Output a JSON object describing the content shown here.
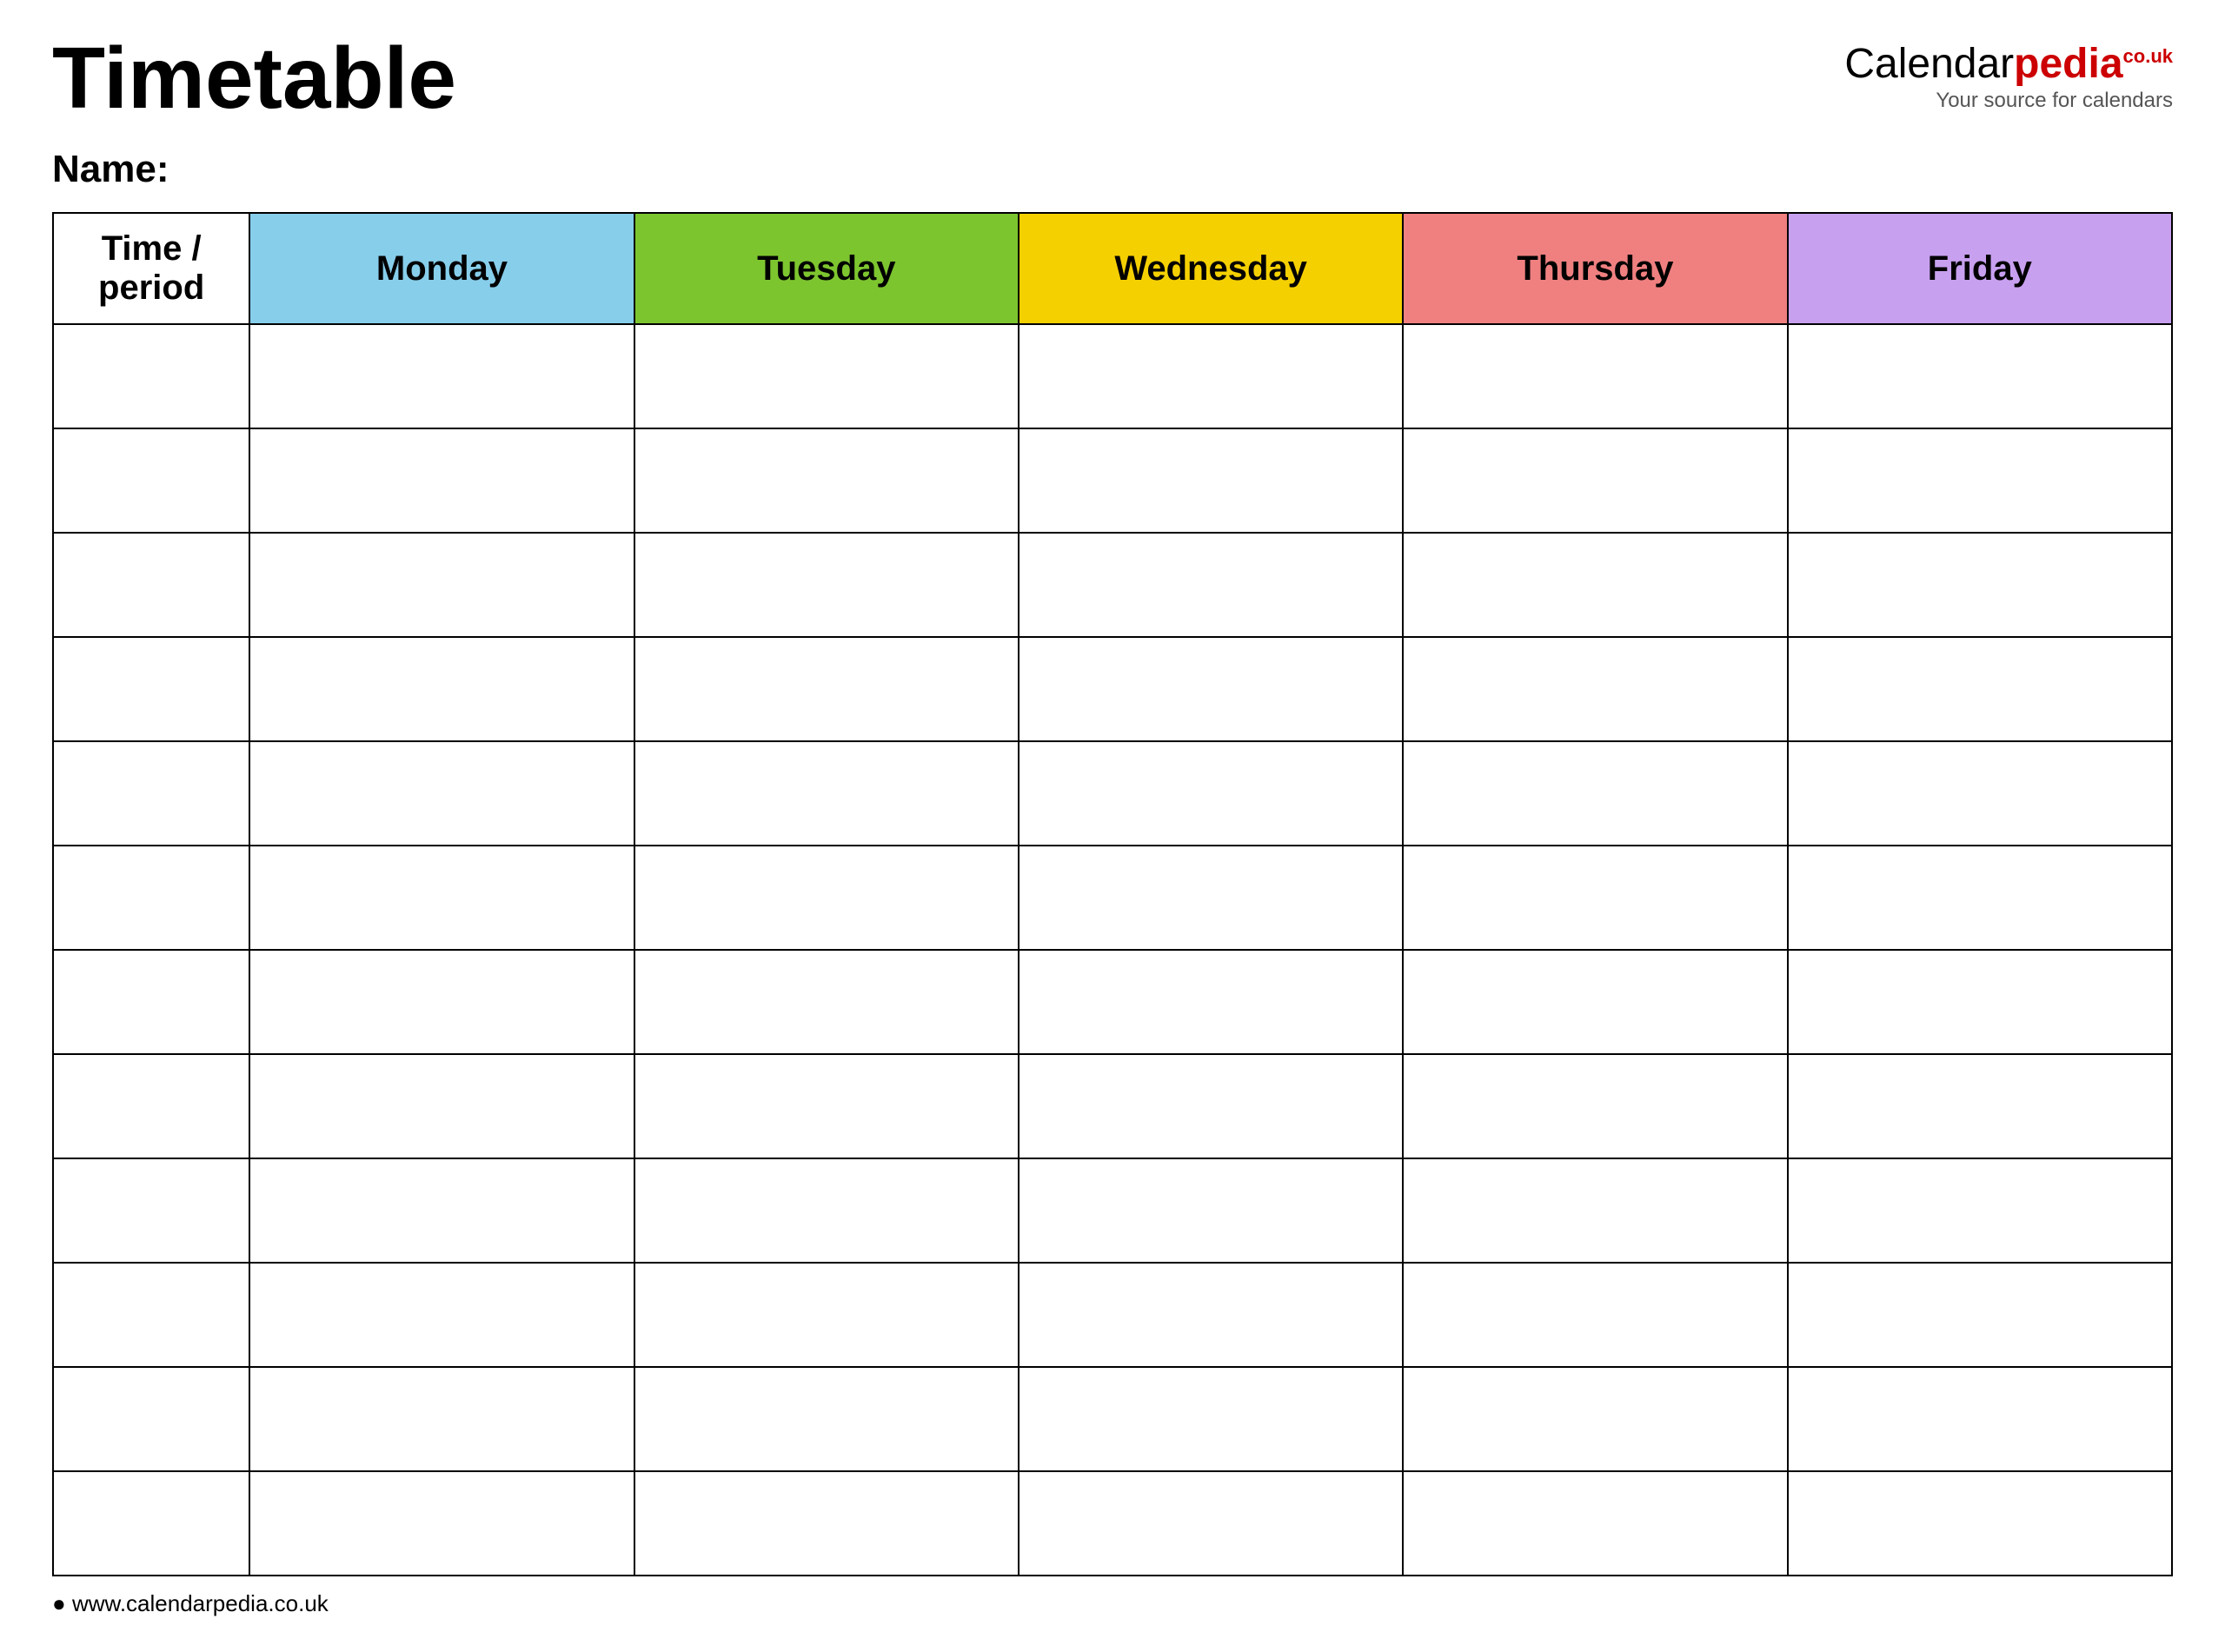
{
  "header": {
    "title": "Timetable",
    "logo": {
      "calendar": "Calendar",
      "pedia": "pedia",
      "couk": "co.uk",
      "tagline": "Your source for calendars"
    }
  },
  "name_label": "Name:",
  "table": {
    "columns": [
      {
        "id": "time",
        "label": "Time / period",
        "color": "#ffffff"
      },
      {
        "id": "monday",
        "label": "Monday",
        "color": "#87ceeb"
      },
      {
        "id": "tuesday",
        "label": "Tuesday",
        "color": "#7dc52f"
      },
      {
        "id": "wednesday",
        "label": "Wednesday",
        "color": "#f5d000"
      },
      {
        "id": "thursday",
        "label": "Thursday",
        "color": "#f08080"
      },
      {
        "id": "friday",
        "label": "Friday",
        "color": "#c8a0f0"
      }
    ],
    "row_count": 12
  },
  "footer": {
    "url": "www.calendarpedia.co.uk"
  }
}
